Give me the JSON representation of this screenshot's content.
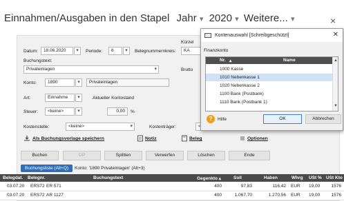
{
  "window": {
    "title": "Einnahmen/Ausgaben in den Stapel",
    "jahr_label": "Jahr",
    "jahr_value": "2020",
    "weitere_label": "Weitere...",
    "dropdown_glyph": "▾",
    "close_glyph": "×"
  },
  "form": {
    "kuerzel_label": "Kürzel",
    "kuerzel_value": "KA",
    "datum_label": "Datum:",
    "datum_value": "18.06.2020",
    "periode_label": "Periode:",
    "periode_value": "6",
    "belegnummernkreis_label": "Belegnummernkreis:",
    "buchungstext_label": "Buchungstext:",
    "buchungstext_value": "Privateinlagen",
    "brutto_label": "Brutto",
    "konto_label": "Konto:",
    "konto_value": "1890",
    "konto_name": "Privateinlagen",
    "art_label": "Art:",
    "art_value": "Einnahme",
    "kontostand_label": "Aktueller Kontostand",
    "steuer_label": "Steuer:",
    "steuer_value": "<keine>",
    "steuer_amount": "0,00",
    "percent_sign": "%",
    "kostenstelle_label": "Kostenstelle:",
    "kostenstelle_value": "<keine>",
    "kostentraeger_label": "Kostenträger:",
    "kostentraeger_value": "<"
  },
  "links": {
    "vorlage": "Als Buchungsvorlage speichern",
    "notiz": "Notiz",
    "beleg": "Beleg",
    "optionen": "Optionen"
  },
  "buttons": {
    "buchen": "Buchen",
    "op": "OP",
    "splitten": "Splitten",
    "verwerfen": "Verwerfen",
    "loeschen": "Löschen",
    "ende": "Ende"
  },
  "tabs": {
    "buchungsliste": "Buchungsliste (Alt+Q)",
    "konto": "Konto: '1890 Privateinlagen' (Alt+3)"
  },
  "table": {
    "headers": [
      "Belegdat.",
      "Belegnr.",
      "Buchungstext",
      "Gegenkto",
      "Soll",
      "Haben",
      "Whrg",
      "USt %",
      "USt Kto"
    ],
    "sort_glyph": "▴",
    "rows": [
      [
        "03.07.20",
        "ERS72",
        "ER 571",
        "400",
        "97,83",
        "116,42",
        "EUR",
        "19,00",
        "1576"
      ],
      [
        "03.07.20",
        "ERS72",
        "AR 1127",
        "400",
        "1.067,70",
        "1.270,56",
        "EUR",
        "19,00",
        "1576"
      ]
    ]
  },
  "dialog": {
    "title": "Kontenauswahl [Schreibgeschützt]",
    "close_glyph": "✕",
    "subtitle": "Finanzkonto",
    "col_nr": "Nr.",
    "col_name": "Name",
    "items": [
      "1000 Kasse",
      "1010 Nebenkasse 1",
      "1020 Nebenkasse 2",
      "1100 Bank (Postbank)",
      "1110 Bank (Postbank 1)"
    ],
    "selected_index": 1,
    "hilfe": "Hilfe",
    "ok": "OK",
    "abbrechen": "Abbrechen"
  },
  "colors": {
    "accent": "#2f6db5",
    "header_dark": "#4a4a4a",
    "help_orange": "#f39c12",
    "pointer_red": "#d9342b"
  }
}
